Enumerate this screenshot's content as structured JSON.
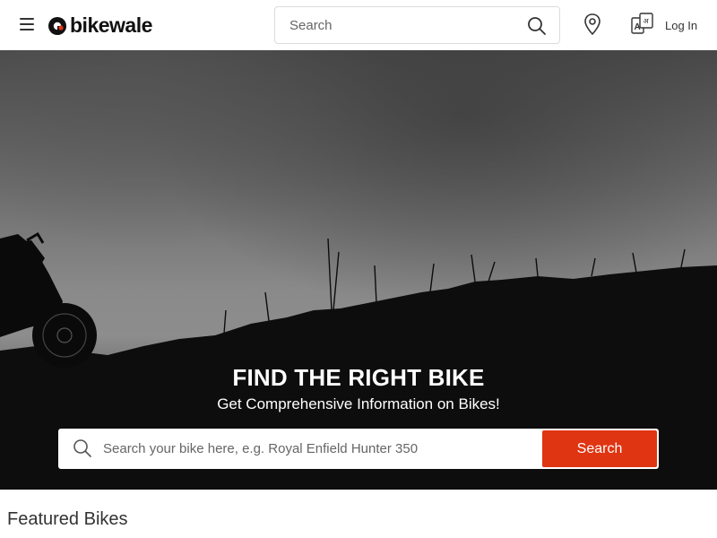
{
  "header": {
    "menu_icon": "hamburger-menu-icon",
    "logo_text": "bikewale",
    "search": {
      "placeholder": "Search",
      "icon": "search-icon"
    },
    "location_icon": "location-pin-icon",
    "language_icon": "language-switch-icon",
    "login_label": "Log In"
  },
  "hero": {
    "title": "FIND THE RIGHT BIKE",
    "subtitle": "Get Comprehensive Information on Bikes!",
    "search": {
      "placeholder": "Search your bike here, e.g. Royal Enfield Hunter 350",
      "icon": "search-icon",
      "button_label": "Search"
    }
  },
  "main": {
    "section_title": "Featured Bikes"
  },
  "colors": {
    "accent": "#e03512",
    "logo_dot": "#e03512"
  }
}
